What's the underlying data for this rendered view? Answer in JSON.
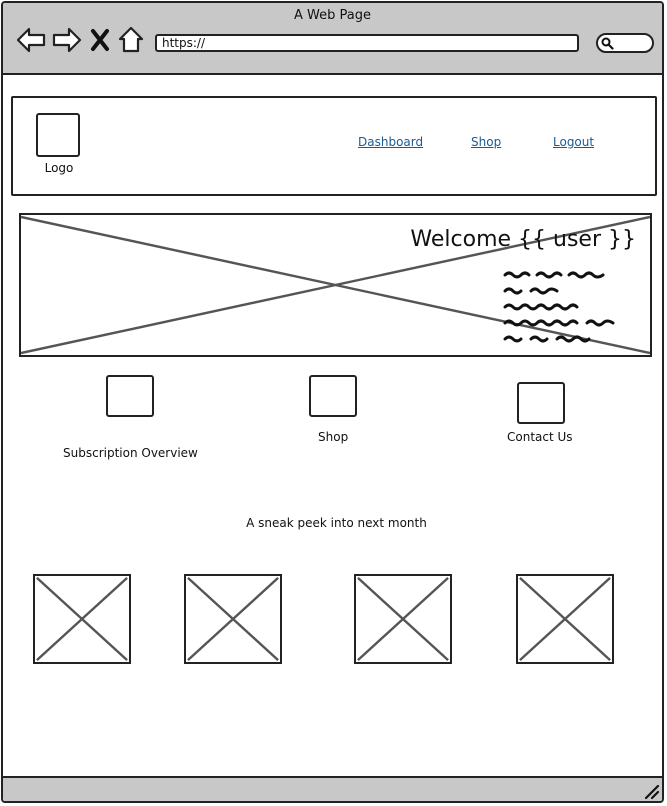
{
  "window": {
    "title": "A Web Page"
  },
  "browser": {
    "url": "https://",
    "icons": [
      "back-arrow-icon",
      "forward-arrow-icon",
      "close-x-icon",
      "home-icon",
      "search-icon"
    ]
  },
  "header": {
    "logo_label": "Logo",
    "nav": [
      {
        "label": "Dashboard"
      },
      {
        "label": "Shop"
      },
      {
        "label": "Logout"
      }
    ]
  },
  "hero": {
    "title": "Welcome {{ user }}"
  },
  "features": [
    {
      "label": "Subscription Overview"
    },
    {
      "label": "Shop"
    },
    {
      "label": "Contact Us"
    }
  ],
  "sneak_peek": {
    "label": "A sneak peek into next month"
  },
  "colors": {
    "chrome": "#c8c8c8",
    "link": "#1a5a96",
    "stroke": "#222222",
    "placeholder_x": "#555555"
  }
}
